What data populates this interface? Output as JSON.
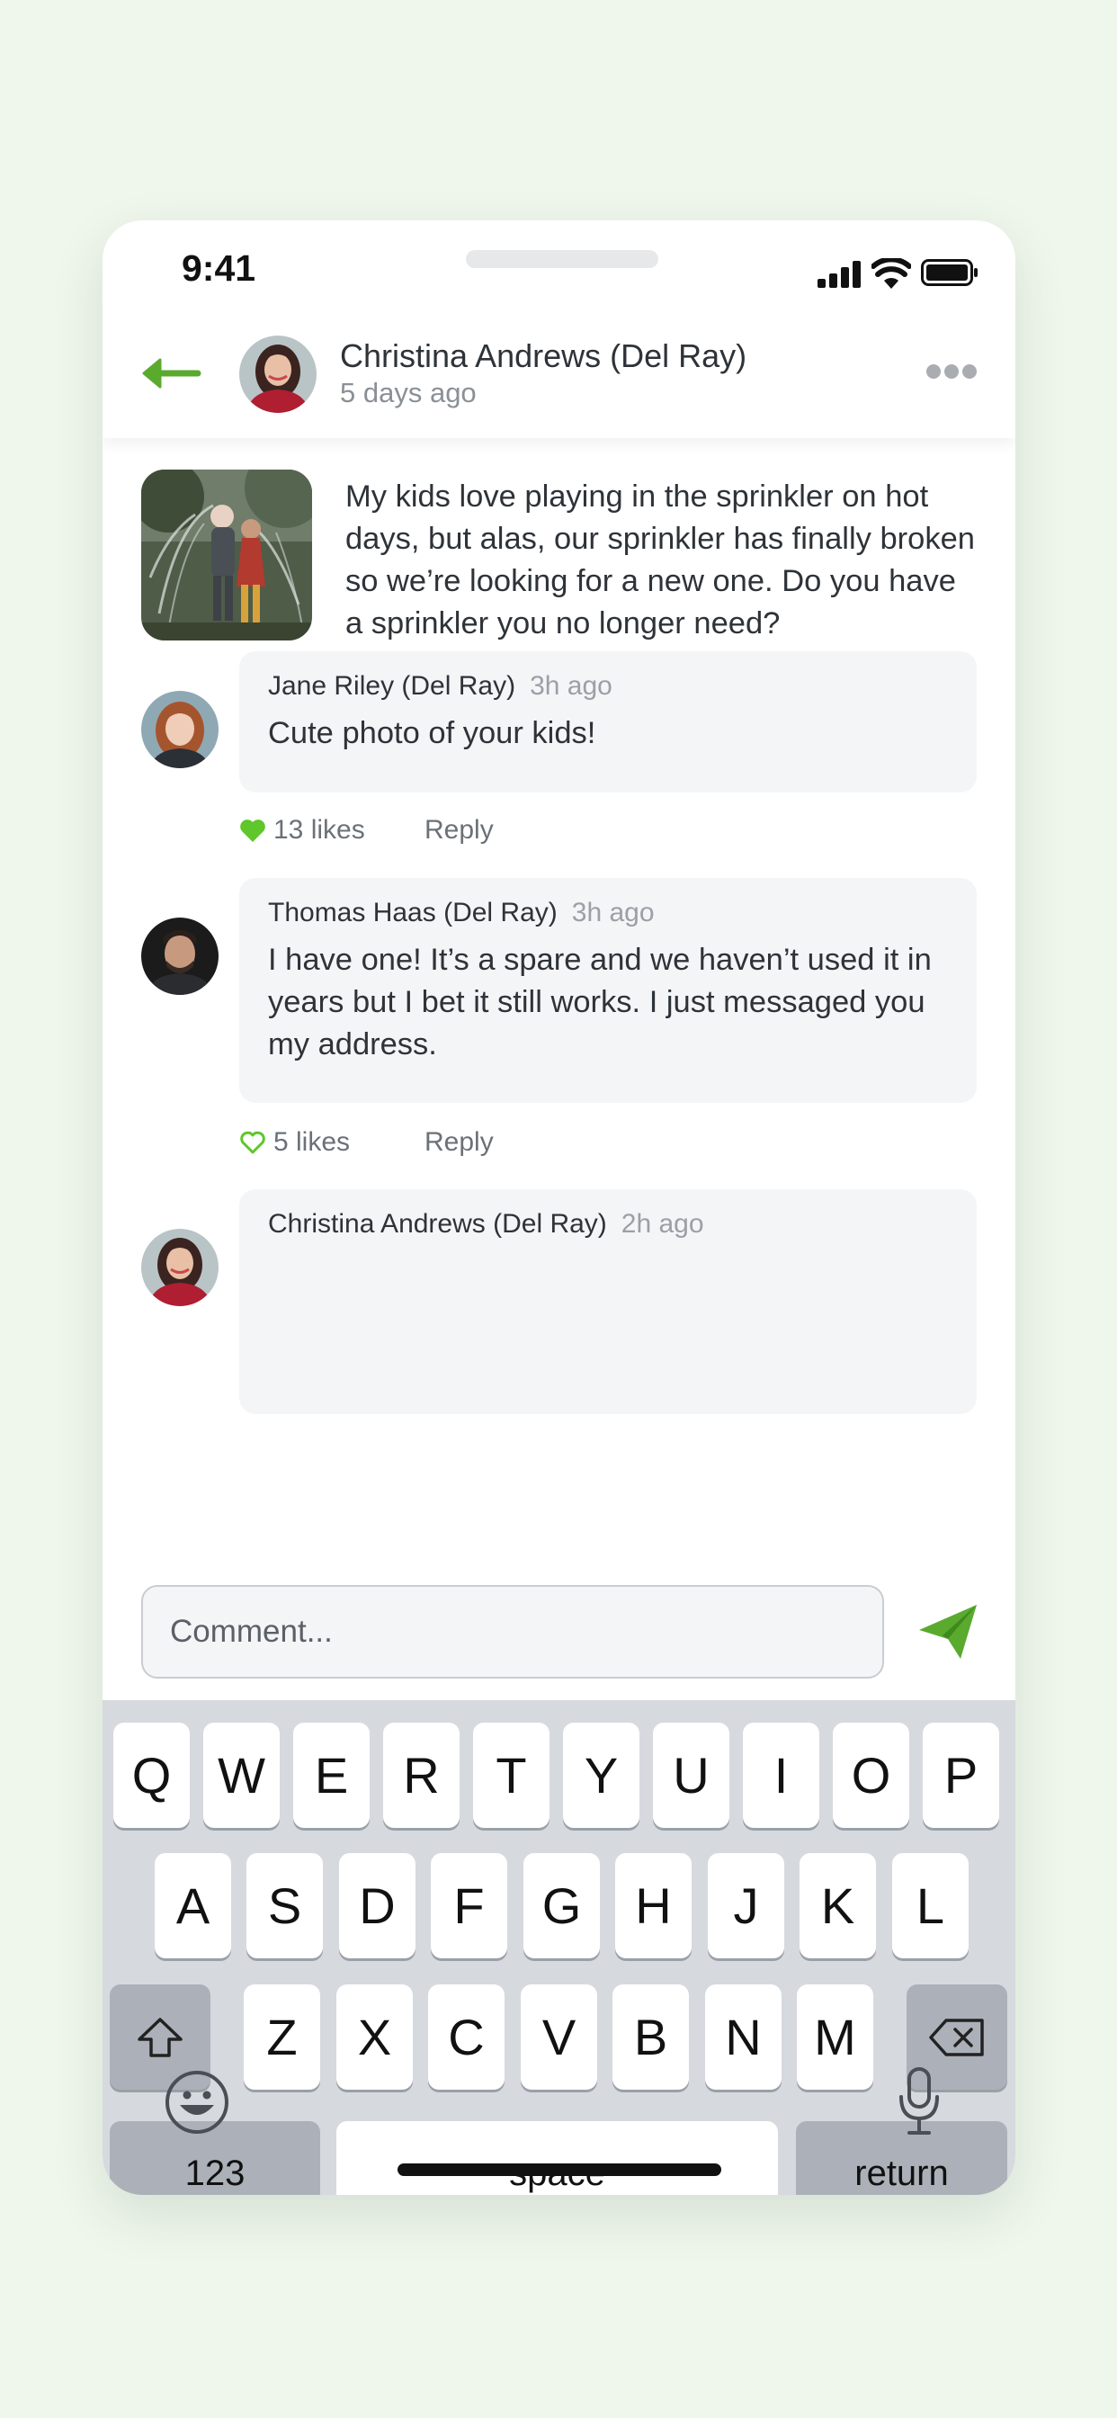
{
  "status_bar": {
    "time": "9:41"
  },
  "header": {
    "name": "Christina Andrews (Del Ray)",
    "subtitle": "5 days ago"
  },
  "post": {
    "text": "My kids love playing in the sprinkler on hot days, but alas, our sprinkler has finally broken so we’re looking for a new one. Do you have a sprinkler you no longer need?"
  },
  "comments": [
    {
      "name": "Jane Riley (Del Ray)",
      "time": "3h ago",
      "text": "Cute photo of your kids!",
      "likes": "13 likes",
      "liked": true,
      "reply": "Reply"
    },
    {
      "name": "Thomas Haas (Del Ray)",
      "time": "3h ago",
      "text": "I have one! It’s a spare and we haven’t used it in years but I bet it still works. I just messaged you my address.",
      "likes": "5 likes",
      "liked": false,
      "reply": "Reply"
    },
    {
      "name": "Christina Andrews (Del Ray)",
      "time": "2h ago",
      "text": ""
    }
  ],
  "composer": {
    "placeholder": "Comment..."
  },
  "keyboard": {
    "row1": [
      "Q",
      "W",
      "E",
      "R",
      "T",
      "Y",
      "U",
      "I",
      "O",
      "P"
    ],
    "row2": [
      "A",
      "S",
      "D",
      "F",
      "G",
      "H",
      "J",
      "K",
      "L"
    ],
    "row3": [
      "Z",
      "X",
      "C",
      "V",
      "B",
      "N",
      "M"
    ],
    "numbers": "123",
    "space": "space",
    "return": "return"
  },
  "colors": {
    "accent": "#5aaa2e",
    "background": "#eff6ec"
  }
}
